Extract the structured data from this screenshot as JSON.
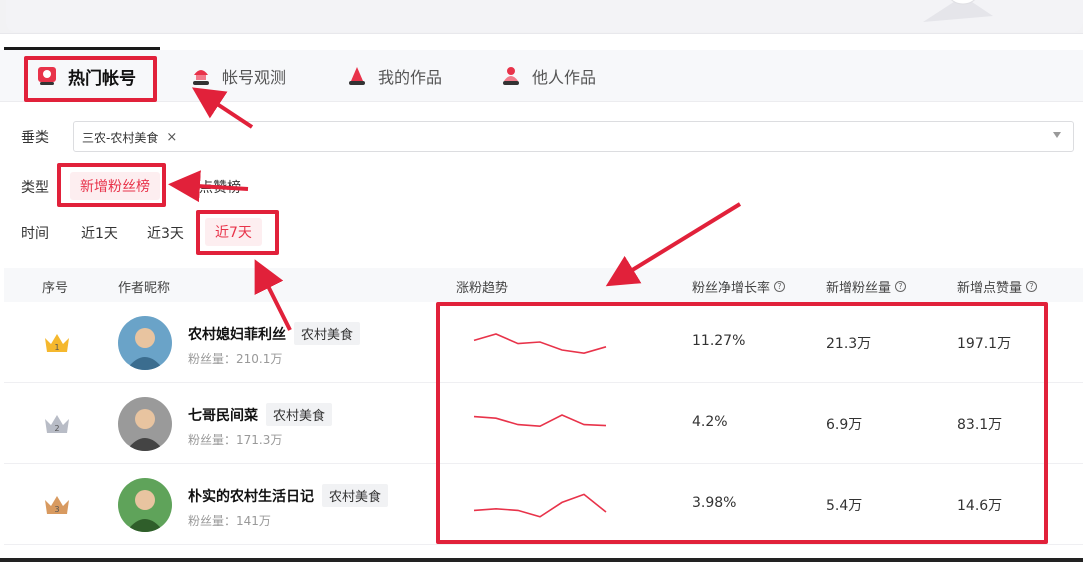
{
  "tabs": [
    {
      "label": "热门帐号",
      "icon": "hot-account-icon",
      "active": true
    },
    {
      "label": "帐号观测",
      "icon": "account-observe-icon",
      "active": false
    },
    {
      "label": "我的作品",
      "icon": "my-works-icon",
      "active": false
    },
    {
      "label": "他人作品",
      "icon": "others-works-icon",
      "active": false
    }
  ],
  "filters": {
    "category_label": "垂类",
    "category_value": "三农-农村美食",
    "type_label": "类型",
    "type_options": [
      "新增粉丝榜",
      "新增点赞榜"
    ],
    "type_visible_fragment": "增点赞榜",
    "time_label": "时间",
    "time_options": [
      "近1天",
      "近3天",
      "近7天"
    ]
  },
  "table": {
    "headers": {
      "rank": "序号",
      "author": "作者昵称",
      "trend": "涨粉趋势",
      "growth_rate": "粉丝净增长率",
      "new_fans": "新增粉丝量",
      "new_likes": "新增点赞量"
    },
    "rows": [
      {
        "rank": "1",
        "name": "农村媳妇菲利丝",
        "tag": "农村美食",
        "fans": "粉丝量：210.1万",
        "trend": [
          0.55,
          0.75,
          0.45,
          0.5,
          0.25,
          0.15,
          0.35
        ],
        "growth_rate": "11.27%",
        "new_fans": "21.3万",
        "new_likes": "197.1万"
      },
      {
        "rank": "2",
        "name": "七哥民间菜",
        "tag": "农村美食",
        "fans": "粉丝量：171.3万",
        "trend": [
          0.7,
          0.65,
          0.45,
          0.4,
          0.75,
          0.45,
          0.42
        ],
        "growth_rate": "4.2%",
        "new_fans": "6.9万",
        "new_likes": "83.1万"
      },
      {
        "rank": "3",
        "name": "朴实的农村生活日记",
        "tag": "农村美食",
        "fans": "粉丝量：141万",
        "trend": [
          0.3,
          0.35,
          0.3,
          0.1,
          0.55,
          0.8,
          0.25
        ],
        "growth_rate": "3.98%",
        "new_fans": "5.4万",
        "new_likes": "14.6万"
      }
    ]
  },
  "colors": {
    "accent": "#e8334a",
    "highlight": "#e1213a",
    "spark": "#e8334a"
  }
}
